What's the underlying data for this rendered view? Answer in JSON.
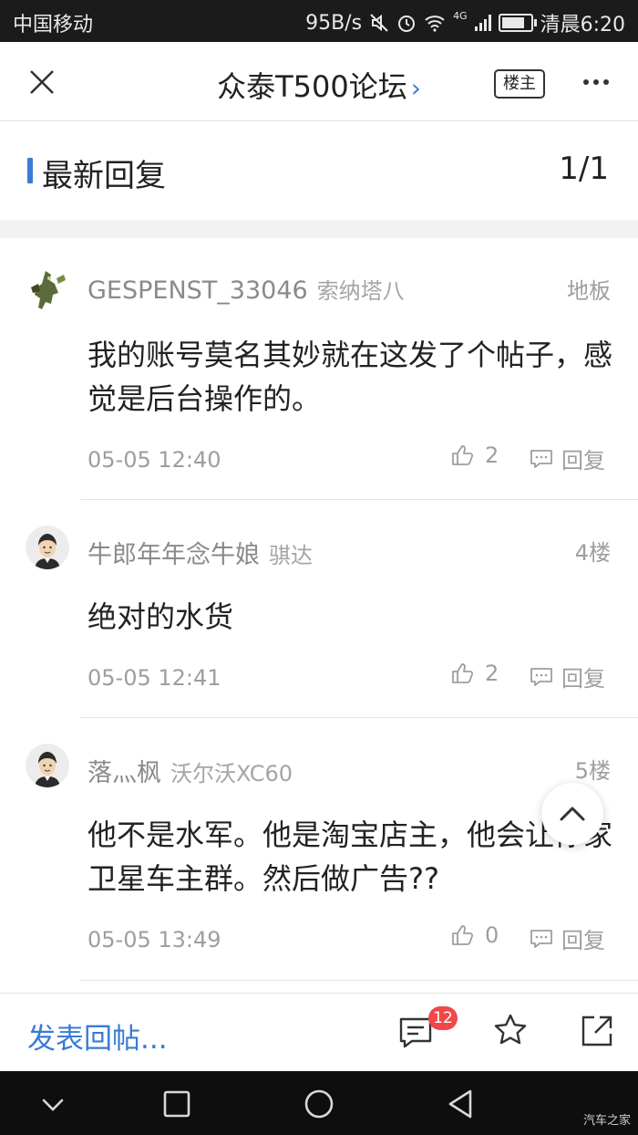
{
  "status_bar": {
    "carrier": "中国移动",
    "speed": "95B/s",
    "network": "4G",
    "time": "清晨6:20"
  },
  "header": {
    "title": "众泰T500论坛",
    "owner_badge": "楼主"
  },
  "section": {
    "title": "最新回复",
    "page": "1/1"
  },
  "posts": [
    {
      "username": "GESPENST_33046",
      "car": "索纳塔八",
      "floor": "地板",
      "content": "我的账号莫名其妙就在这发了个帖子，感觉是后台操作的。",
      "time": "05-05 12:40",
      "likes": "2",
      "reply_label": "回复"
    },
    {
      "username": "牛郎年年念牛娘",
      "car": "骐达",
      "floor": "4楼",
      "content": "绝对的水货",
      "time": "05-05 12:41",
      "likes": "2",
      "reply_label": "回复"
    },
    {
      "username": "落灬枫",
      "car": "沃尔沃XC60",
      "floor": "5楼",
      "content": "他不是水军。他是淘宝店主，他会让你家卫星车主群。然后做广告??",
      "time": "05-05 13:49",
      "likes": "0",
      "reply_label": "回复"
    }
  ],
  "action_bar": {
    "reply_placeholder": "发表回帖...",
    "comment_count": "12"
  },
  "watermark": "汽车之家",
  "colors": {
    "accent": "#3a7bd5",
    "badge_red": "#f04848",
    "status_bar_bg": "#1b1b1b",
    "nav_bar_bg": "#0e0e0e"
  }
}
